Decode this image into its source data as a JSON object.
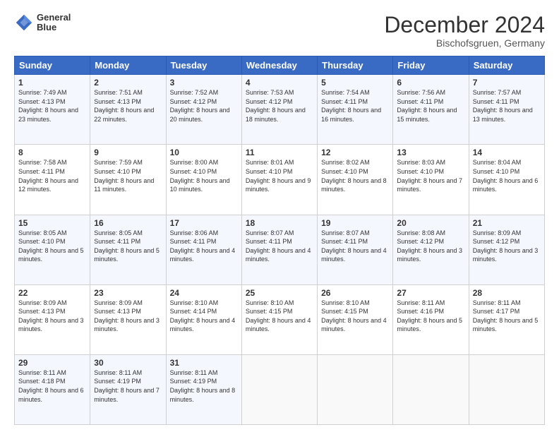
{
  "logo": {
    "line1": "General",
    "line2": "Blue"
  },
  "header": {
    "month": "December 2024",
    "location": "Bischofsgruen, Germany"
  },
  "days": [
    "Sunday",
    "Monday",
    "Tuesday",
    "Wednesday",
    "Thursday",
    "Friday",
    "Saturday"
  ],
  "weeks": [
    [
      {
        "num": "1",
        "sunrise": "7:49 AM",
        "sunset": "4:13 PM",
        "daylight": "8 hours and 23 minutes."
      },
      {
        "num": "2",
        "sunrise": "7:51 AM",
        "sunset": "4:13 PM",
        "daylight": "8 hours and 22 minutes."
      },
      {
        "num": "3",
        "sunrise": "7:52 AM",
        "sunset": "4:12 PM",
        "daylight": "8 hours and 20 minutes."
      },
      {
        "num": "4",
        "sunrise": "7:53 AM",
        "sunset": "4:12 PM",
        "daylight": "8 hours and 18 minutes."
      },
      {
        "num": "5",
        "sunrise": "7:54 AM",
        "sunset": "4:11 PM",
        "daylight": "8 hours and 16 minutes."
      },
      {
        "num": "6",
        "sunrise": "7:56 AM",
        "sunset": "4:11 PM",
        "daylight": "8 hours and 15 minutes."
      },
      {
        "num": "7",
        "sunrise": "7:57 AM",
        "sunset": "4:11 PM",
        "daylight": "8 hours and 13 minutes."
      }
    ],
    [
      {
        "num": "8",
        "sunrise": "7:58 AM",
        "sunset": "4:11 PM",
        "daylight": "8 hours and 12 minutes."
      },
      {
        "num": "9",
        "sunrise": "7:59 AM",
        "sunset": "4:10 PM",
        "daylight": "8 hours and 11 minutes."
      },
      {
        "num": "10",
        "sunrise": "8:00 AM",
        "sunset": "4:10 PM",
        "daylight": "8 hours and 10 minutes."
      },
      {
        "num": "11",
        "sunrise": "8:01 AM",
        "sunset": "4:10 PM",
        "daylight": "8 hours and 9 minutes."
      },
      {
        "num": "12",
        "sunrise": "8:02 AM",
        "sunset": "4:10 PM",
        "daylight": "8 hours and 8 minutes."
      },
      {
        "num": "13",
        "sunrise": "8:03 AM",
        "sunset": "4:10 PM",
        "daylight": "8 hours and 7 minutes."
      },
      {
        "num": "14",
        "sunrise": "8:04 AM",
        "sunset": "4:10 PM",
        "daylight": "8 hours and 6 minutes."
      }
    ],
    [
      {
        "num": "15",
        "sunrise": "8:05 AM",
        "sunset": "4:10 PM",
        "daylight": "8 hours and 5 minutes."
      },
      {
        "num": "16",
        "sunrise": "8:05 AM",
        "sunset": "4:11 PM",
        "daylight": "8 hours and 5 minutes."
      },
      {
        "num": "17",
        "sunrise": "8:06 AM",
        "sunset": "4:11 PM",
        "daylight": "8 hours and 4 minutes."
      },
      {
        "num": "18",
        "sunrise": "8:07 AM",
        "sunset": "4:11 PM",
        "daylight": "8 hours and 4 minutes."
      },
      {
        "num": "19",
        "sunrise": "8:07 AM",
        "sunset": "4:11 PM",
        "daylight": "8 hours and 4 minutes."
      },
      {
        "num": "20",
        "sunrise": "8:08 AM",
        "sunset": "4:12 PM",
        "daylight": "8 hours and 3 minutes."
      },
      {
        "num": "21",
        "sunrise": "8:09 AM",
        "sunset": "4:12 PM",
        "daylight": "8 hours and 3 minutes."
      }
    ],
    [
      {
        "num": "22",
        "sunrise": "8:09 AM",
        "sunset": "4:13 PM",
        "daylight": "8 hours and 3 minutes."
      },
      {
        "num": "23",
        "sunrise": "8:09 AM",
        "sunset": "4:13 PM",
        "daylight": "8 hours and 3 minutes."
      },
      {
        "num": "24",
        "sunrise": "8:10 AM",
        "sunset": "4:14 PM",
        "daylight": "8 hours and 4 minutes."
      },
      {
        "num": "25",
        "sunrise": "8:10 AM",
        "sunset": "4:15 PM",
        "daylight": "8 hours and 4 minutes."
      },
      {
        "num": "26",
        "sunrise": "8:10 AM",
        "sunset": "4:15 PM",
        "daylight": "8 hours and 4 minutes."
      },
      {
        "num": "27",
        "sunrise": "8:11 AM",
        "sunset": "4:16 PM",
        "daylight": "8 hours and 5 minutes."
      },
      {
        "num": "28",
        "sunrise": "8:11 AM",
        "sunset": "4:17 PM",
        "daylight": "8 hours and 5 minutes."
      }
    ],
    [
      {
        "num": "29",
        "sunrise": "8:11 AM",
        "sunset": "4:18 PM",
        "daylight": "8 hours and 6 minutes."
      },
      {
        "num": "30",
        "sunrise": "8:11 AM",
        "sunset": "4:19 PM",
        "daylight": "8 hours and 7 minutes."
      },
      {
        "num": "31",
        "sunrise": "8:11 AM",
        "sunset": "4:19 PM",
        "daylight": "8 hours and 8 minutes."
      },
      null,
      null,
      null,
      null
    ]
  ]
}
